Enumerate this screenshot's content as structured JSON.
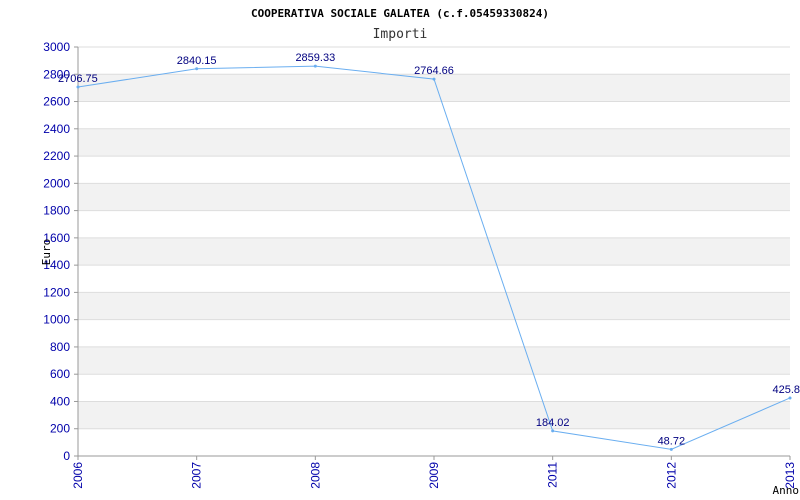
{
  "chart_data": {
    "type": "line",
    "title": "COOPERATIVA SOCIALE GALATEA (c.f.05459330824)",
    "subtitle": "Importi",
    "xlabel": "Anno",
    "ylabel": "Euro",
    "categories": [
      "2006",
      "2007",
      "2008",
      "2009",
      "2011",
      "2012",
      "2013"
    ],
    "values": [
      2706.75,
      2840.15,
      2859.33,
      2764.66,
      184.02,
      48.72,
      425.8
    ],
    "data_labels": [
      "2706.75",
      "2840.15",
      "2859.33",
      "2764.66",
      "184.02",
      "48.72",
      "425.8"
    ],
    "ylim": [
      0,
      3000
    ],
    "yticks": [
      0,
      200,
      400,
      600,
      800,
      1000,
      1200,
      1400,
      1600,
      1800,
      2000,
      2200,
      2400,
      2600,
      2800,
      3000
    ],
    "grid": true,
    "band_color": "#f2f2f2",
    "line_color": "#6aaef0",
    "tick_color": "#0000aa",
    "label_color": "#000080"
  }
}
